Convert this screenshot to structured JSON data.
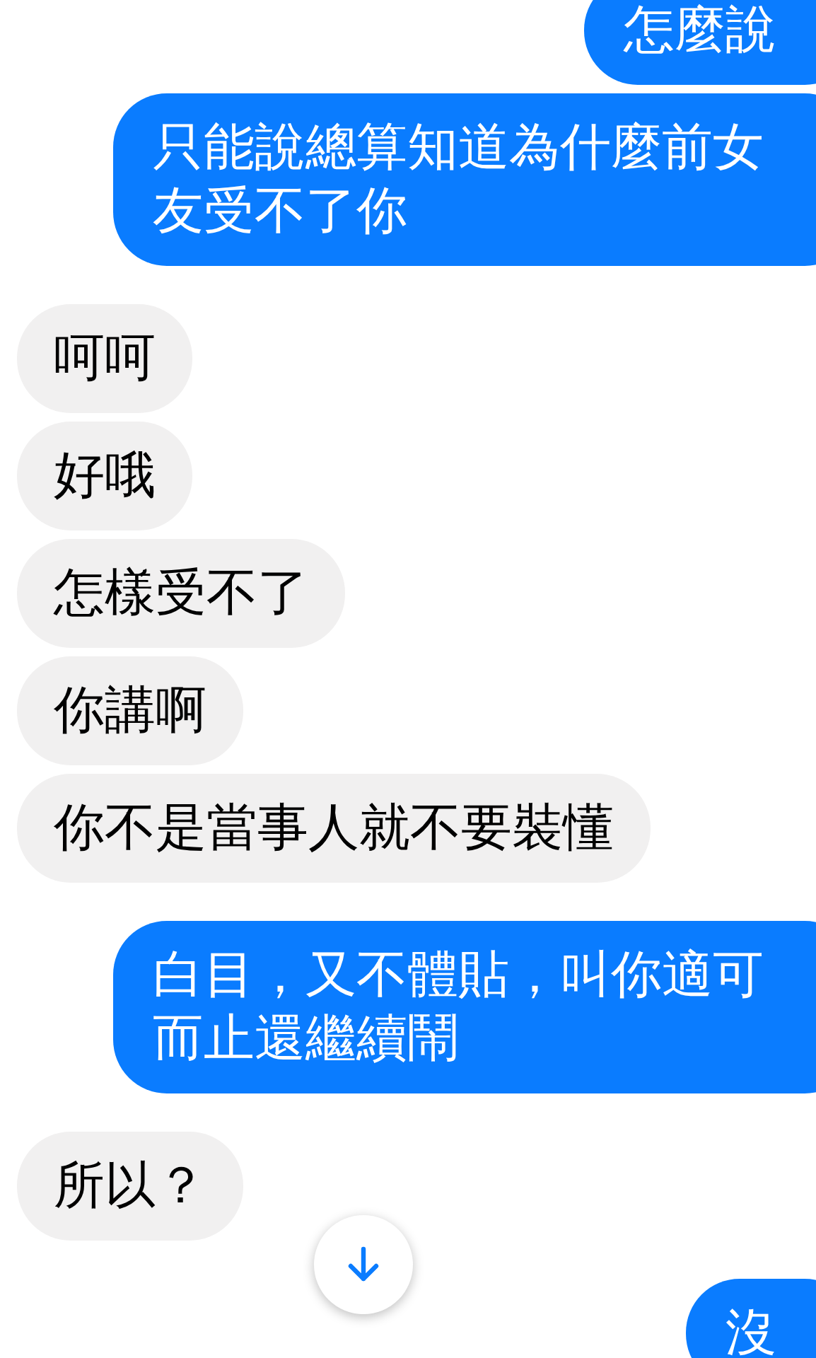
{
  "messages": [
    {
      "kind": "sent",
      "text": "怎麼說"
    },
    {
      "kind": "sent",
      "text": "只能說總算知道為什麼前女友受不了你"
    },
    {
      "kind": "received",
      "text": "呵呵"
    },
    {
      "kind": "received",
      "text": "好哦"
    },
    {
      "kind": "received",
      "text": "怎樣受不了"
    },
    {
      "kind": "received",
      "text": "你講啊"
    },
    {
      "kind": "received",
      "text": "你不是當事人就不要裝懂"
    },
    {
      "kind": "sent",
      "text": "白目，又不體貼，叫你適可而止還繼續鬧"
    },
    {
      "kind": "received",
      "text": "所以？"
    },
    {
      "kind": "sent",
      "text": "沒"
    }
  ]
}
